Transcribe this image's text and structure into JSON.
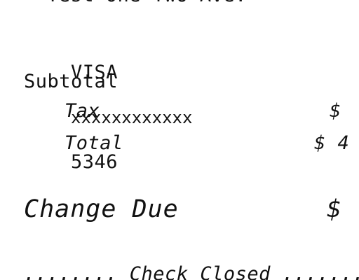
{
  "receipt": {
    "top_line": "*   Test One Two Ave.  *",
    "card_line": {
      "brand": "VISA",
      "masked": "xxxxxxxxxxxx",
      "last4": "5346"
    },
    "subtotal_label": "Subtotal",
    "tax": {
      "label": "Tax",
      "value": "$"
    },
    "total": {
      "label": "Total",
      "value": "$ 4"
    },
    "change_due": {
      "label": "Change Due",
      "value": "$"
    },
    "footer_line": "........ Check Closed ........"
  }
}
